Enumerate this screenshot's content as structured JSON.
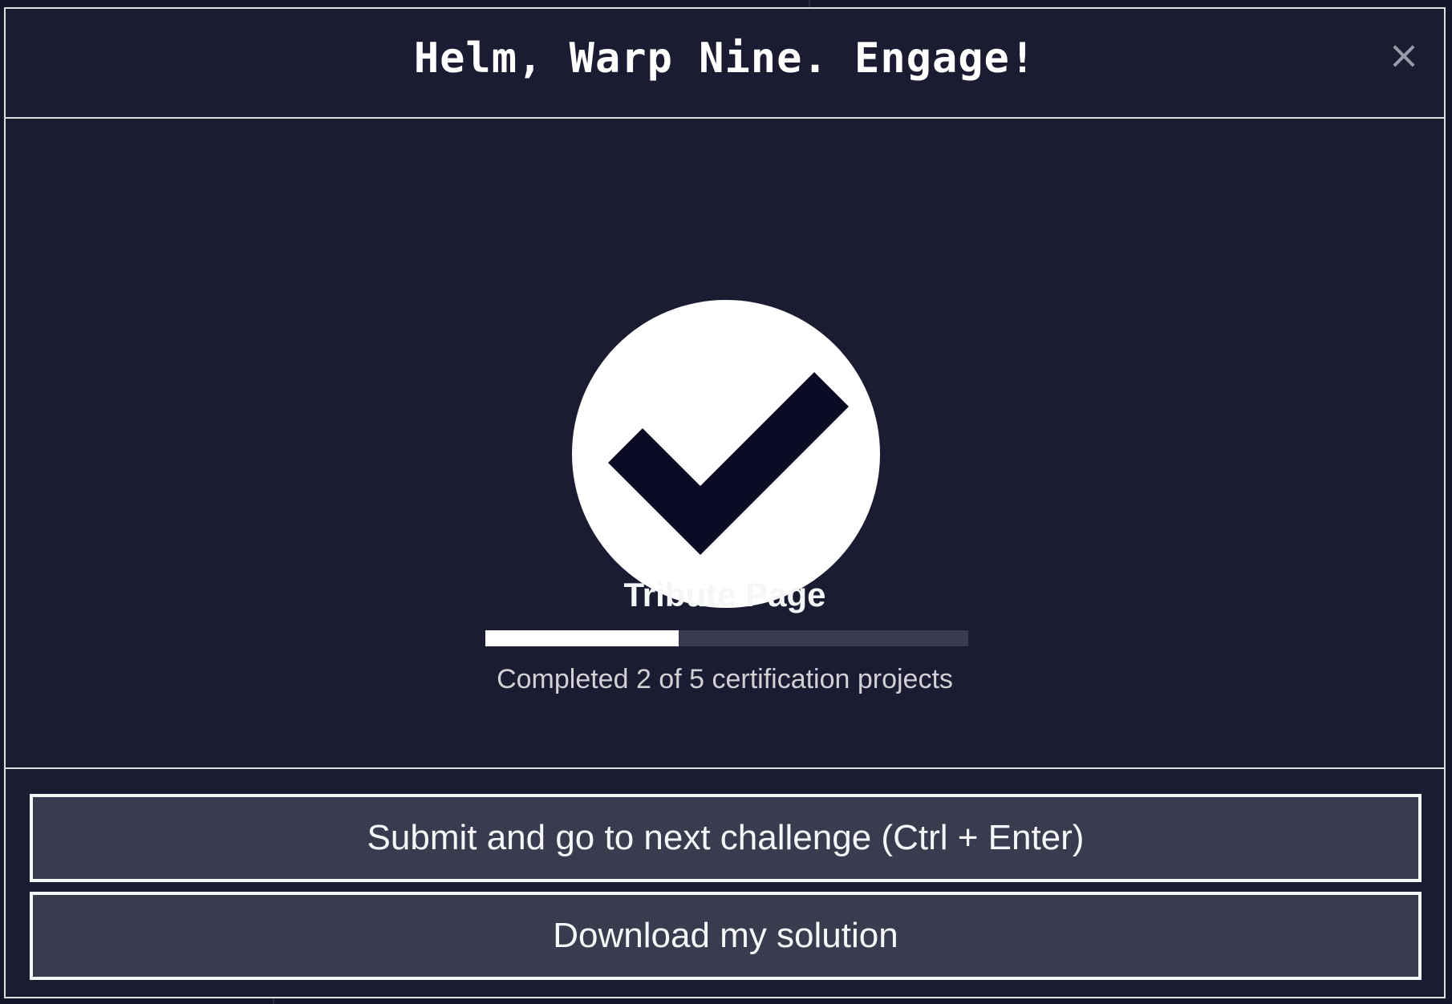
{
  "modal": {
    "title": "Helm, Warp Nine. Engage!",
    "close_label": "×",
    "icon": "check-circle-icon"
  },
  "project": {
    "name": "Tribute Page",
    "completed": 2,
    "total": 5,
    "caption": "Completed 2 of 5 certification projects"
  },
  "actions": {
    "submit_label": "Submit and go to next challenge (Ctrl + Enter)",
    "download_label": "Download my solution"
  },
  "colors": {
    "modal_background": "#1b1b32",
    "button_background": "#3b3b4f",
    "border": "#dfdfe2",
    "checkmark": "#0a0a23",
    "progress_fill": "#ffffff",
    "progress_track": "#3b3b4f"
  }
}
